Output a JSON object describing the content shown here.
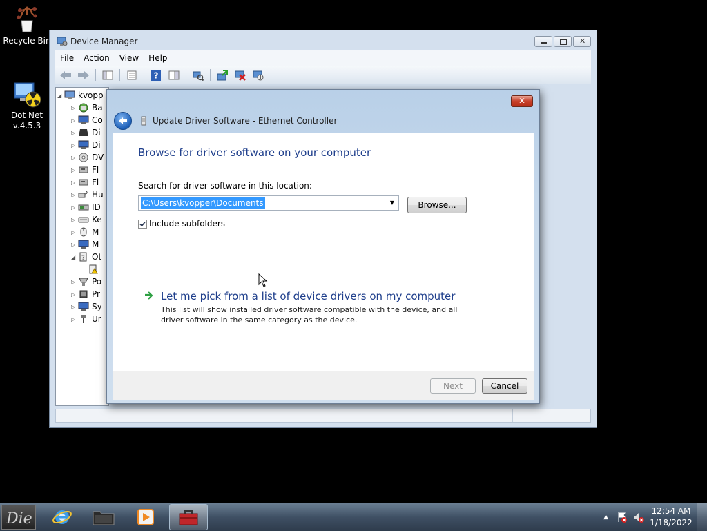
{
  "desktop": {
    "icons": [
      {
        "label": "Recycle Bin",
        "icon": "recycle-bin-icon"
      },
      {
        "label": "Dot Net v.4.5.3",
        "icon": "dotnet-installer-icon"
      }
    ]
  },
  "device_manager": {
    "title": "Device Manager",
    "menu": [
      "File",
      "Action",
      "View",
      "Help"
    ],
    "tree": [
      {
        "label": "kvopp",
        "arrow": "◢"
      },
      {
        "label": "Ba",
        "arrow": "▷"
      },
      {
        "label": "Co",
        "arrow": "▷"
      },
      {
        "label": "Di",
        "arrow": "▷"
      },
      {
        "label": "Di",
        "arrow": "▷"
      },
      {
        "label": "DV",
        "arrow": "▷"
      },
      {
        "label": "Fl",
        "arrow": "▷"
      },
      {
        "label": "Fl",
        "arrow": "▷"
      },
      {
        "label": "Hu",
        "arrow": "▷"
      },
      {
        "label": "ID",
        "arrow": "▷"
      },
      {
        "label": "Ke",
        "arrow": "▷"
      },
      {
        "label": "M",
        "arrow": "▷"
      },
      {
        "label": "M",
        "arrow": "▷"
      },
      {
        "label": "Ot",
        "arrow": "◢"
      },
      {
        "label": "",
        "arrow": ""
      },
      {
        "label": "Po",
        "arrow": "▷"
      },
      {
        "label": "Pr",
        "arrow": "▷"
      },
      {
        "label": "Sy",
        "arrow": "▷"
      },
      {
        "label": "Ur",
        "arrow": "▷"
      }
    ]
  },
  "dialog": {
    "close_label": "✕",
    "title": "Update Driver Software - Ethernet Controller",
    "heading": "Browse for driver software on your computer",
    "search_label": "Search for driver software in this location:",
    "path_value": "C:\\Users\\kvopper\\Documents",
    "browse_label": "Browse...",
    "include_subfolders_label": "Include subfolders",
    "include_subfolders_checked": true,
    "pick_title": "Let me pick from a list of device drivers on my computer",
    "pick_description": "This list will show installed driver software compatible with the device, and all driver software in the same category as the device.",
    "next_label": "Next",
    "cancel_label": "Cancel"
  },
  "taskbar": {
    "start_logo": "Die",
    "clock_time": "12:54 AM",
    "clock_date": "1/18/2022",
    "tray_expand": "▲"
  }
}
